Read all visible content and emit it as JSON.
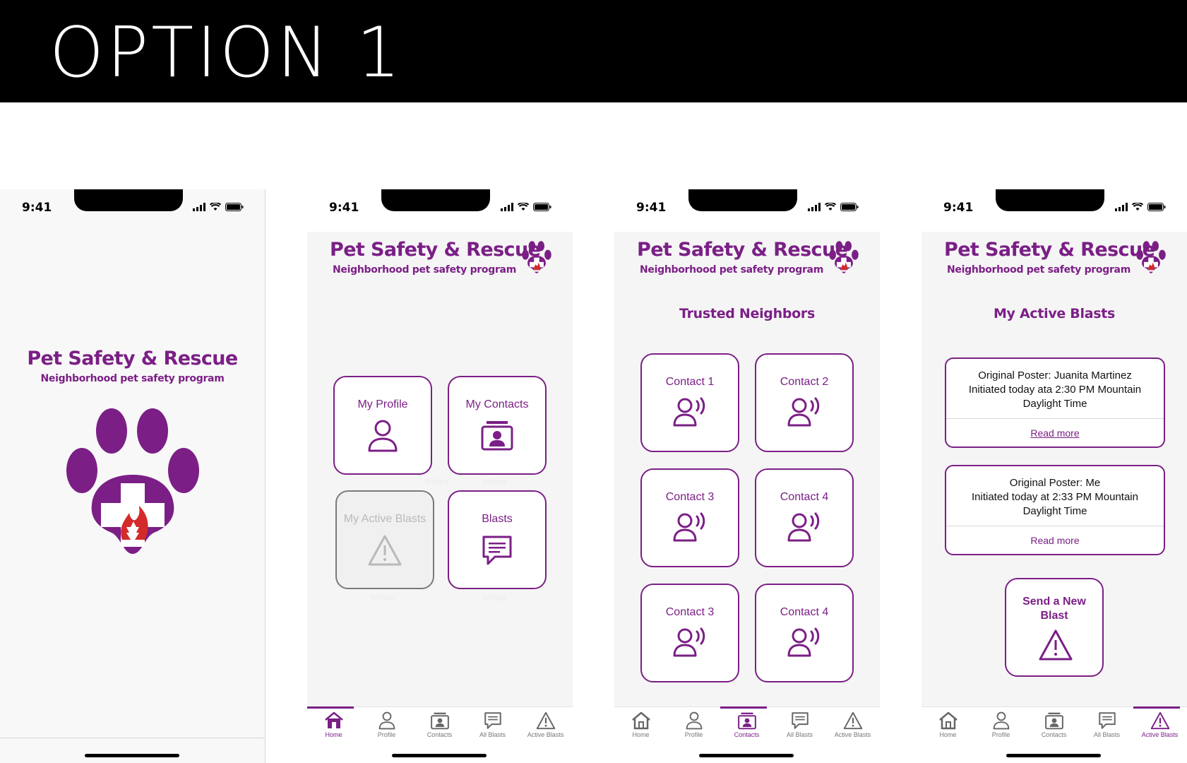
{
  "banner": {
    "title": "OPTION 1"
  },
  "status": {
    "time": "9:41"
  },
  "app": {
    "title": "Pet Safety & Rescue",
    "subtitle": "Neighborhood pet safety program"
  },
  "home": {
    "tiles": [
      {
        "label": "My Profile",
        "icon": "user-icon"
      },
      {
        "label": "My Contacts",
        "icon": "contact-card-icon"
      },
      {
        "label": "My Active Blasts",
        "icon": "warning-icon",
        "disabled": true
      },
      {
        "label": "Blasts",
        "icon": "chat-icon"
      }
    ],
    "widget_caption": "Widget"
  },
  "contacts": {
    "title": "Trusted Neighbors",
    "items": [
      "Contact 1",
      "Contact 2",
      "Contact 3",
      "Contact 4",
      "Contact 3",
      "Contact 4"
    ]
  },
  "blasts": {
    "title": "My Active Blasts",
    "cards": [
      {
        "poster": "Original Poster: Juanita Martinez",
        "initiated": "Initiated today ata 2:30 PM Mountain Daylight Time",
        "link": "Read more"
      },
      {
        "poster": "Original Poster: Me",
        "initiated": "Initiated today at 2:33 PM Mountain Daylight Time",
        "link": "Read more"
      }
    ],
    "send_label": "Send a New Blast"
  },
  "tabs": [
    "Home",
    "Profile",
    "Contacts",
    "All Blasts",
    "Active Blasts"
  ],
  "colors": {
    "brand": "#7b1f86",
    "flame": "#d42a2a"
  }
}
